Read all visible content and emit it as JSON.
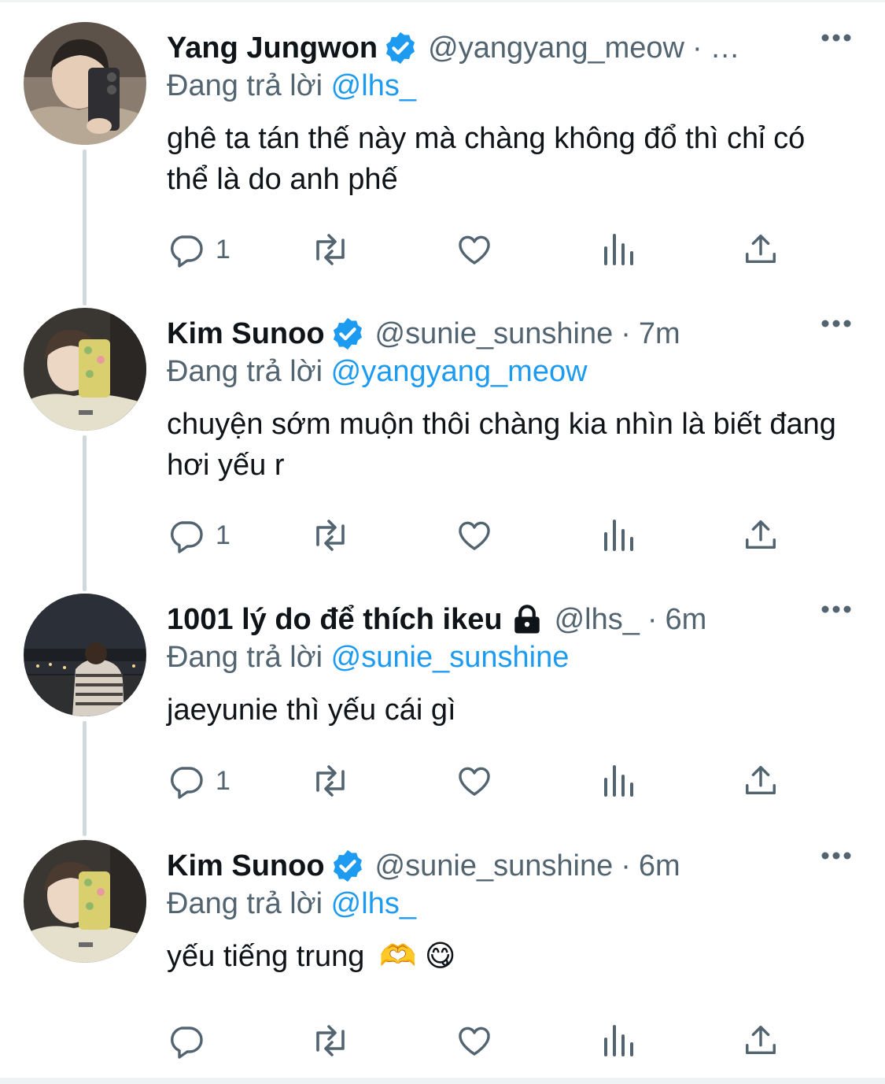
{
  "tweets": [
    {
      "name": "Yang Jungwon",
      "verified": true,
      "locked": false,
      "handle": "@yangyang_meow",
      "separator": "·",
      "time": "…",
      "reply_prefix": "Đang trả lời",
      "reply_to": "@lhs_",
      "text": "ghê ta tán thế này mà chàng không đổ thì chỉ có thể là do anh phế",
      "emoji": "",
      "reply_count": "1"
    },
    {
      "name": "Kim Sunoo",
      "verified": true,
      "locked": false,
      "handle": "@sunie_sunshine",
      "separator": "·",
      "time": "7m",
      "reply_prefix": "Đang trả lời",
      "reply_to": "@yangyang_meow",
      "text": "chuyện sớm muộn thôi chàng kia nhìn là biết đang hơi yếu r",
      "emoji": "",
      "reply_count": "1"
    },
    {
      "name": "1001 lý do để thích ikeu",
      "verified": false,
      "locked": true,
      "handle": "@lhs_",
      "separator": "·",
      "time": "6m",
      "reply_prefix": "Đang trả lời",
      "reply_to": "@sunie_sunshine",
      "text": "jaeyunie thì yếu cái gì",
      "emoji": "",
      "reply_count": "1"
    },
    {
      "name": "Kim Sunoo",
      "verified": true,
      "locked": false,
      "handle": "@sunie_sunshine",
      "separator": "·",
      "time": "6m",
      "reply_prefix": "Đang trả lời",
      "reply_to": "@lhs_",
      "text": "yếu tiếng trung",
      "emoji": "🫶 😋",
      "reply_count": ""
    }
  ],
  "icons": {
    "reply": "speech-bubble-icon",
    "retweet": "retweet-icon",
    "like": "heart-icon",
    "views": "bar-chart-icon",
    "share": "share-upload-icon",
    "more": "more-dots-icon",
    "verified": "verified-badge-icon",
    "locked": "lock-icon"
  },
  "colors": {
    "text": "#0f1419",
    "secondary": "#536471",
    "link": "#1d9bf0",
    "thread_line": "#cfd9de"
  }
}
